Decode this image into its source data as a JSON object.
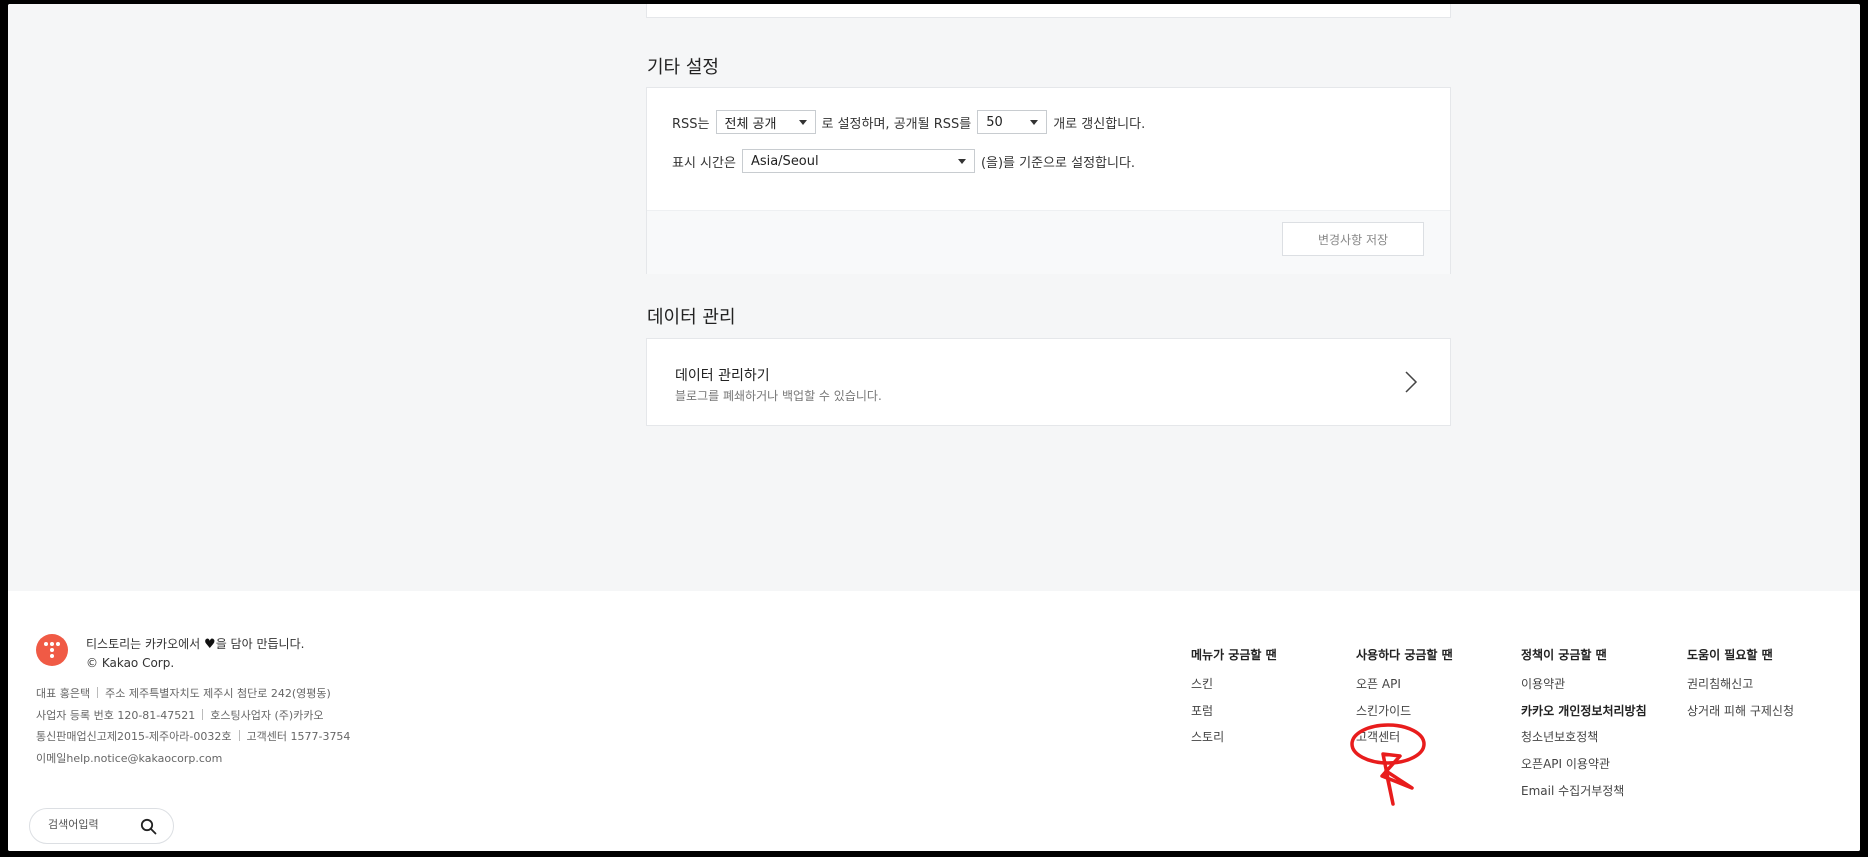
{
  "sections": {
    "other_settings_title": "기타 설정",
    "data_management_title": "데이터 관리"
  },
  "rss": {
    "prefix": "RSS는",
    "visibility_value": "전체 공개",
    "middle": "로 설정하며, 공개될 RSS를",
    "count_value": "50",
    "suffix": "개로 갱신합니다."
  },
  "timezone": {
    "prefix": "표시 시간은",
    "value": "Asia/Seoul",
    "suffix": "(을)를 기준으로 설정합니다."
  },
  "save_button": "변경사항 저장",
  "data_management": {
    "title": "데이터 관리하기",
    "description": "블로그를 폐쇄하거나 백업할 수 있습니다."
  },
  "footer": {
    "tagline_before": "티스토리는 카카오에서",
    "tagline_after": "을 담아 만듭니다.",
    "copyright": "© Kakao Corp.",
    "info": {
      "ceo": "대표 홍은택",
      "address": "주소 제주특별자치도 제주시 첨단로 242(영평동)",
      "biz_no": "사업자 등록 번호 120-81-47521",
      "hosting": "호스팅사업자 (주)카카오",
      "mail_order": "통신판매업신고제2015-제주아라-0032호",
      "cs": "고객센터 1577-3754",
      "email": "이메일help.notice@kakaocorp.com"
    },
    "search_placeholder": "검색어입력",
    "columns": [
      {
        "title": "메뉴가 궁금할 땐",
        "links": [
          "스킨",
          "포럼",
          "스토리"
        ]
      },
      {
        "title": "사용하다 궁금할 땐",
        "links": [
          "오픈 API",
          "스킨가이드",
          "고객센터"
        ]
      },
      {
        "title": "정책이 궁금할 땐",
        "links": [
          "이용약관",
          "카카오 개인정보처리방침",
          "청소년보호정책",
          "오픈API 이용약관",
          "Email 수집거부정책"
        ]
      },
      {
        "title": "도움이 필요할 땐",
        "links": [
          "권리침해신고",
          "상거래 피해 구제신청"
        ]
      }
    ]
  },
  "colors": {
    "logo": "#f05a45",
    "annotation": "#e81c1c"
  },
  "icons": {
    "logo": "tistory-logo-icon",
    "heart": "heart-icon",
    "search": "search-icon",
    "chevron": "chevron-right-icon",
    "dropdown": "caret-down-icon"
  }
}
